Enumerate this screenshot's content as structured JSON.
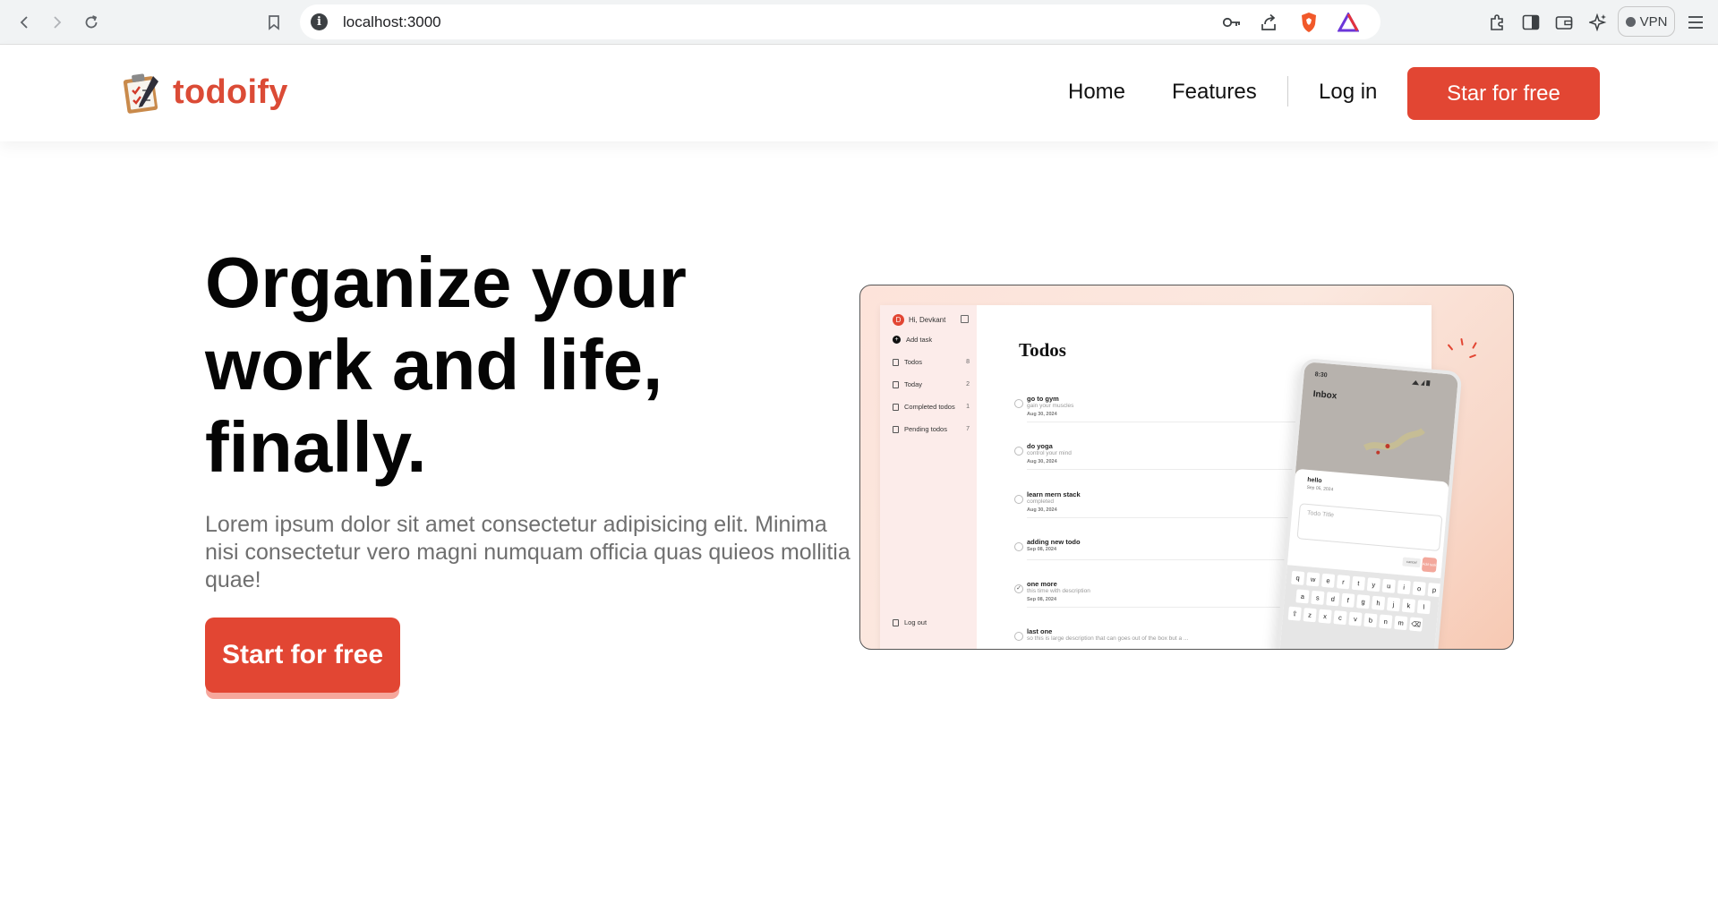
{
  "browser": {
    "url": "localhost:3000",
    "vpn_label": "VPN",
    "icons": [
      "back-icon",
      "forward-icon",
      "reload-icon",
      "bookmark-icon",
      "site-info-icon",
      "key-icon",
      "share-icon",
      "brave-shields-icon",
      "brave-rewards-icon",
      "extensions-icon",
      "sidebar-icon",
      "wallet-icon",
      "leo-ai-icon",
      "menu-icon"
    ]
  },
  "header": {
    "logo_text": "todoify",
    "nav": {
      "home": "Home",
      "features": "Features",
      "login": "Log in"
    },
    "cta": "Star for free"
  },
  "hero": {
    "title": "Organize your work and life, finally.",
    "description": "Lorem ipsum dolor sit amet consectetur adipisicing elit. Minima nisi consectetur vero magni numquam officia quas quieos mollitia quae!",
    "cta": "Start for free"
  },
  "preview": {
    "user_initial": "D",
    "user_greeting": "Hi, Devkant",
    "sidebar": [
      {
        "label": "Add task",
        "count": ""
      },
      {
        "label": "Todos",
        "count": "8"
      },
      {
        "label": "Today",
        "count": "2"
      },
      {
        "label": "Completed todos",
        "count": "1"
      },
      {
        "label": "Pending todos",
        "count": "7"
      }
    ],
    "logout": "Log out",
    "title": "Todos",
    "todos": [
      {
        "name": "go to gym",
        "sub": "gain your muscles",
        "date": "Aug 30, 2024",
        "done": false
      },
      {
        "name": "do yoga",
        "sub": "control your mind",
        "date": "Aug 30, 2024",
        "done": false
      },
      {
        "name": "learn mern stack",
        "sub": "completed",
        "date": "Aug 30, 2024",
        "done": false
      },
      {
        "name": "adding new todo",
        "sub": "",
        "date": "Sep 08, 2024",
        "done": false
      },
      {
        "name": "one more",
        "sub": "this time with description",
        "date": "Sep 08, 2024",
        "done": true
      },
      {
        "name": "last one",
        "sub": "so this is large description that can goes out of the box but a ...",
        "date": "",
        "done": false
      }
    ],
    "phone": {
      "time": "8:30",
      "inbox": "Inbox",
      "item": "hello",
      "item_date": "Sep 05, 2024",
      "input_placeholder": "Todo Title",
      "cancel": "cancel",
      "add": "Add task",
      "kb_rows": [
        [
          "q",
          "w",
          "e",
          "r",
          "t",
          "y",
          "u",
          "i",
          "o",
          "p"
        ],
        [
          "a",
          "s",
          "d",
          "f",
          "g",
          "h",
          "j",
          "k",
          "l"
        ],
        [
          "⇧",
          "z",
          "x",
          "c",
          "v",
          "b",
          "n",
          "m",
          "⌫"
        ]
      ]
    }
  },
  "colors": {
    "brand": "#e24633",
    "logo": "#db4b36",
    "cta_shadow": "#f6a79c",
    "text_muted": "#6f6f6f"
  }
}
